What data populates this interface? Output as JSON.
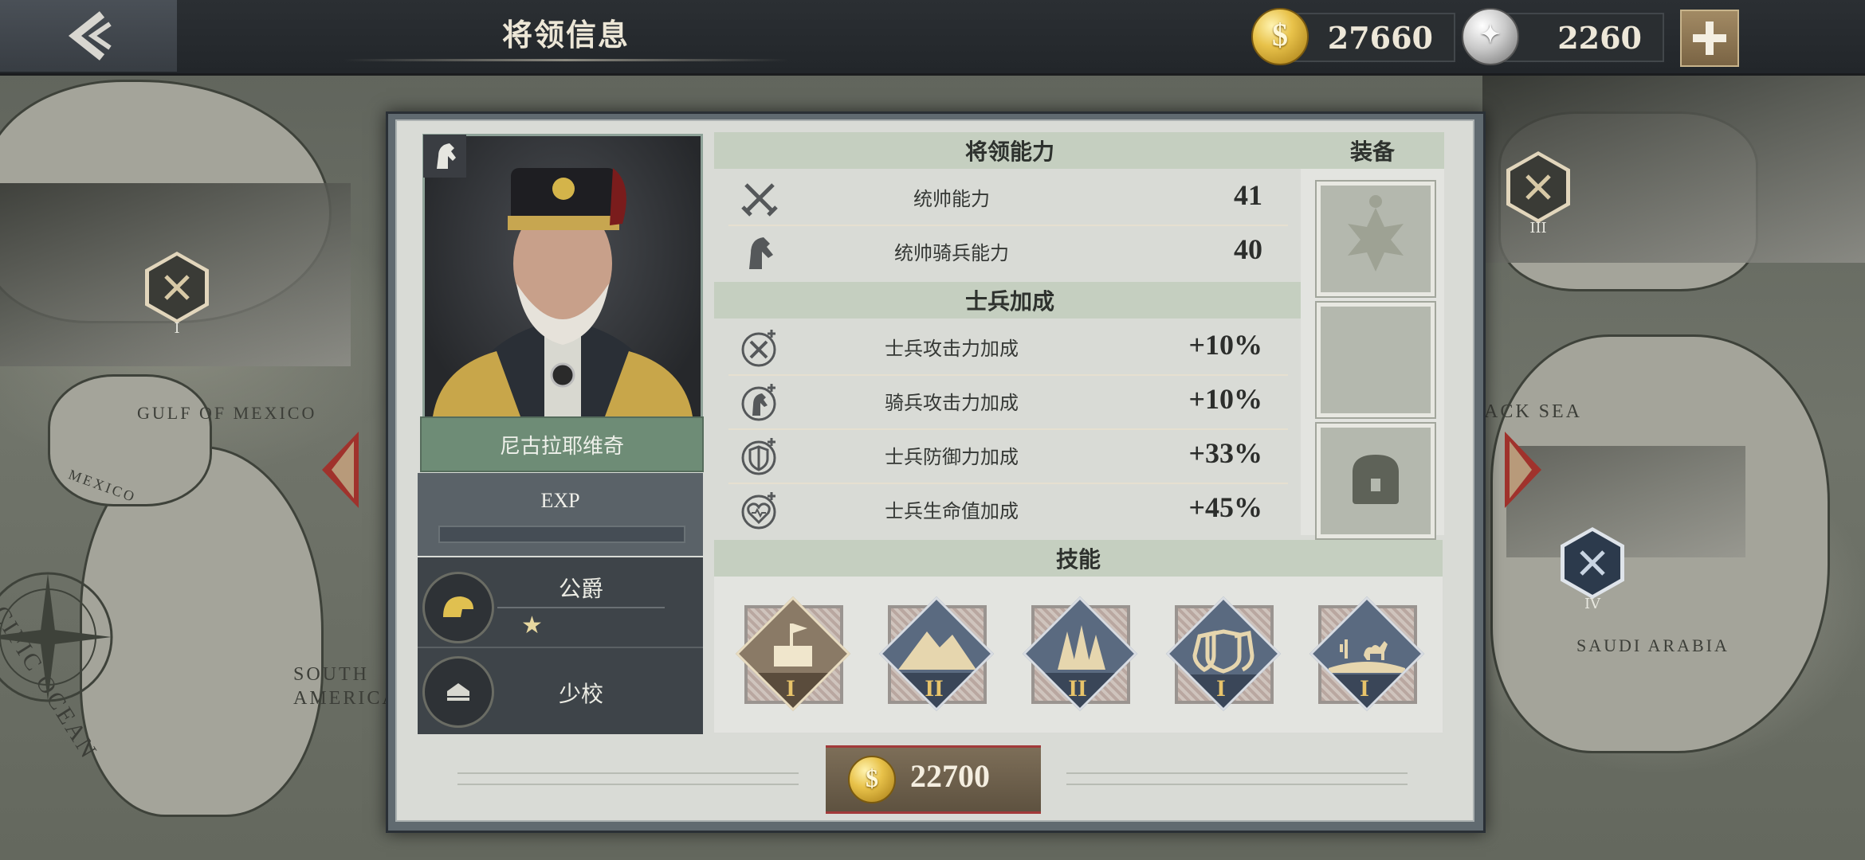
{
  "header": {
    "title": "将领信息",
    "back_icon": "back-arrow-icon"
  },
  "resources": {
    "gold": "27660",
    "silver": "2260",
    "add_icon": "plus-icon"
  },
  "map_labels": {
    "gulf": "GULF OF MEXICO",
    "mexico": "MEXICO",
    "pacific": "PACIFIC OCEAN",
    "south_america": "SOUTH AMERICA",
    "black_sea": "ACK SEA",
    "saudi": "SAUDI ARABIA",
    "units": [
      "I",
      "III",
      "IV"
    ]
  },
  "general": {
    "name": "尼古拉耶维奇",
    "exp_label": "EXP",
    "exp_progress": 0,
    "title_rank": "公爵",
    "stars": "★",
    "military_rank": "少校"
  },
  "sections": {
    "ability": "将领能力",
    "bonus": "士兵加成",
    "equipment": "装备",
    "skills": "技能"
  },
  "abilities": [
    {
      "icon": "crossed-swords-icon",
      "label": "统帅能力",
      "value": "41"
    },
    {
      "icon": "horse-head-icon",
      "label": "统帅骑兵能力",
      "value": "40"
    }
  ],
  "bonuses": [
    {
      "icon": "attack-bonus-icon",
      "label": "士兵攻击力加成",
      "value": "+10%"
    },
    {
      "icon": "cavalry-bonus-icon",
      "label": "骑兵攻击力加成",
      "value": "+10%"
    },
    {
      "icon": "defense-bonus-icon",
      "label": "士兵防御力加成",
      "value": "+33%"
    },
    {
      "icon": "health-bonus-icon",
      "label": "士兵生命值加成",
      "value": "+45%"
    }
  ],
  "equipment_slots": [
    "medal-slot",
    "empty-slot",
    "locked-chest-slot"
  ],
  "skills": [
    {
      "icon": "fortification-skill-icon",
      "level": "I",
      "color": "#8a7a66"
    },
    {
      "icon": "mountain-skill-icon",
      "level": "II",
      "color": "#5a6a80"
    },
    {
      "icon": "forest-skill-icon",
      "level": "II",
      "color": "#5a6a80"
    },
    {
      "icon": "shield-wall-skill-icon",
      "level": "I",
      "color": "#5a6a80"
    },
    {
      "icon": "desert-skill-icon",
      "level": "I",
      "color": "#5a6a80"
    }
  ],
  "cost": {
    "value": "22700"
  },
  "colors": {
    "gold": "#e8c24a",
    "panel": "#d9dbd6",
    "header": "#c5cfc0",
    "accent_red": "#a23a3a"
  }
}
